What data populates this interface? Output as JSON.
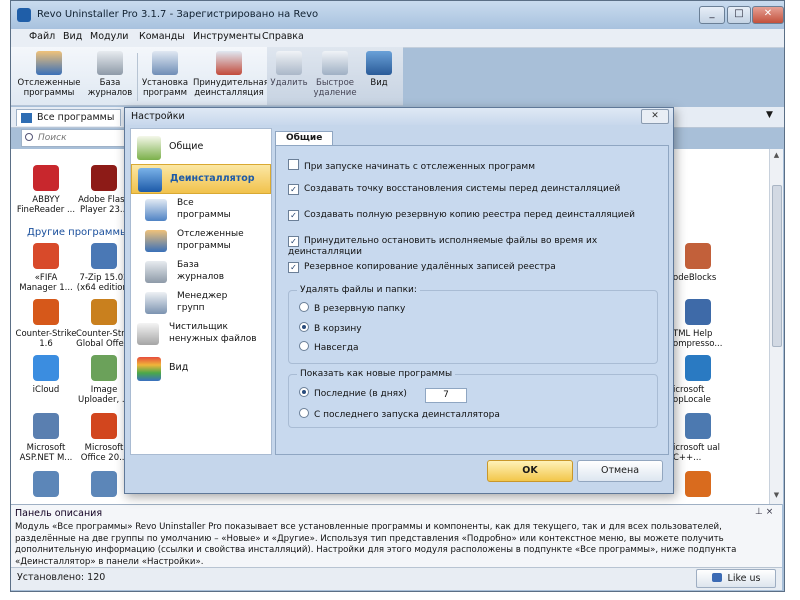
{
  "window": {
    "title": "Revo Uninstaller Pro 3.1.7 - Зарегистрировано на Revo",
    "controls": {
      "minimize": "_",
      "maximize": "□",
      "close": "✕"
    }
  },
  "menu": [
    "Файл",
    "Вид",
    "Модули",
    "Команды",
    "Инструменты",
    "Справка"
  ],
  "toolbar": {
    "traced": "Отслеженные программы",
    "logs": "База журналов",
    "install": "Установка программ",
    "forced": "Принудительная деинсталляция",
    "delete": "Удалить",
    "quick_delete": "Быстрое удаление",
    "view": "Вид"
  },
  "tabs": {
    "all_programs": "Все программы"
  },
  "search": {
    "placeholder": "Поиск"
  },
  "programs_top": [
    {
      "name": "ABBYY FineReader ...",
      "color": "#c8272d"
    },
    {
      "name": "Adobe Flash Player 23...",
      "color": "#8d1b17"
    }
  ],
  "group_other": "Другие программы",
  "programs_other": [
    {
      "name": "«FIFA Manager 1...",
      "color": "#d84a2a"
    },
    {
      "name": "7-Zip 15.02 (x64 edition)",
      "color": "#4a78b5"
    },
    {
      "name": "Counter-Strike 1.6",
      "color": "#d6581a"
    },
    {
      "name": "Counter-Str... Global Offe...",
      "color": "#c9801e"
    },
    {
      "name": "iCloud",
      "color": "#3b8de0"
    },
    {
      "name": "Image Uploader, ...",
      "color": "#6ba15a"
    },
    {
      "name": "Microsoft ASP.NET M...",
      "color": "#5a7fb0"
    },
    {
      "name": "Microsoft Office 20...",
      "color": "#d2461e"
    }
  ],
  "programs_right": [
    {
      "name": "odeBlocks",
      "color": "#c2603a"
    },
    {
      "name": "TML Help ompresso...",
      "color": "#3e6aa8"
    },
    {
      "name": "icrosoft opLocale",
      "color": "#2a7ac2"
    },
    {
      "name": "icrosoft ual C++...",
      "color": "#4c79b0"
    }
  ],
  "description": {
    "title": "Панель описания",
    "pin": "⊥ ×",
    "text": "Модуль «Все программы» Revo Uninstaller Pro показывает все установленные программы и компоненты, как для текущего, так и для всех пользователей, разделённые на две группы по умолчанию – «Новые» и «Другие». Используя тип представления «Подробно» или контекстное меню, вы можете получить дополнительную информацию (ссылки и свойства инсталляций). Настройки для этого модуля расположены в подпункте «Все программы», ниже подпункта «Деинсталлятор» в панели «Настройки»."
  },
  "status": {
    "installed": "Установлено: 120",
    "like": "Like us"
  },
  "settings": {
    "title": "Настройки",
    "close": "✕",
    "nav": {
      "general": "Общие",
      "uninstaller": "Деинсталлятор",
      "sub": [
        "Все программы",
        "Отслеженные программы",
        "База журналов",
        "Менеджер групп",
        "Чистильщик ненужных файлов"
      ],
      "view": "Вид"
    },
    "tab": "Общие",
    "checkboxes": [
      {
        "label": "При запуске начинать с отслеженных программ",
        "checked": false
      },
      {
        "label": "Создавать точку восстановления системы перед деинсталляцией",
        "checked": true
      },
      {
        "label": "Создавать полную резервную копию реестра перед деинсталляцией",
        "checked": true
      },
      {
        "label": "Принудительно остановить исполняемые файлы во время их деинсталляции",
        "checked": true
      },
      {
        "label": "Резервное копирование удалённых записей реестра",
        "checked": true
      }
    ],
    "delete_group": {
      "title": "Удалять файлы и папки:",
      "options": [
        {
          "label": "В резервную папку",
          "selected": false
        },
        {
          "label": "В корзину",
          "selected": true
        },
        {
          "label": "Навсегда",
          "selected": false
        }
      ]
    },
    "new_group": {
      "title": "Показать как новые программы",
      "last_days_label": "Последние (в днях)",
      "last_days_value": "7",
      "since_label": "С последнего запуска деинсталлятора",
      "selected": "last_days"
    },
    "ok": "OK",
    "cancel": "Отмена"
  }
}
